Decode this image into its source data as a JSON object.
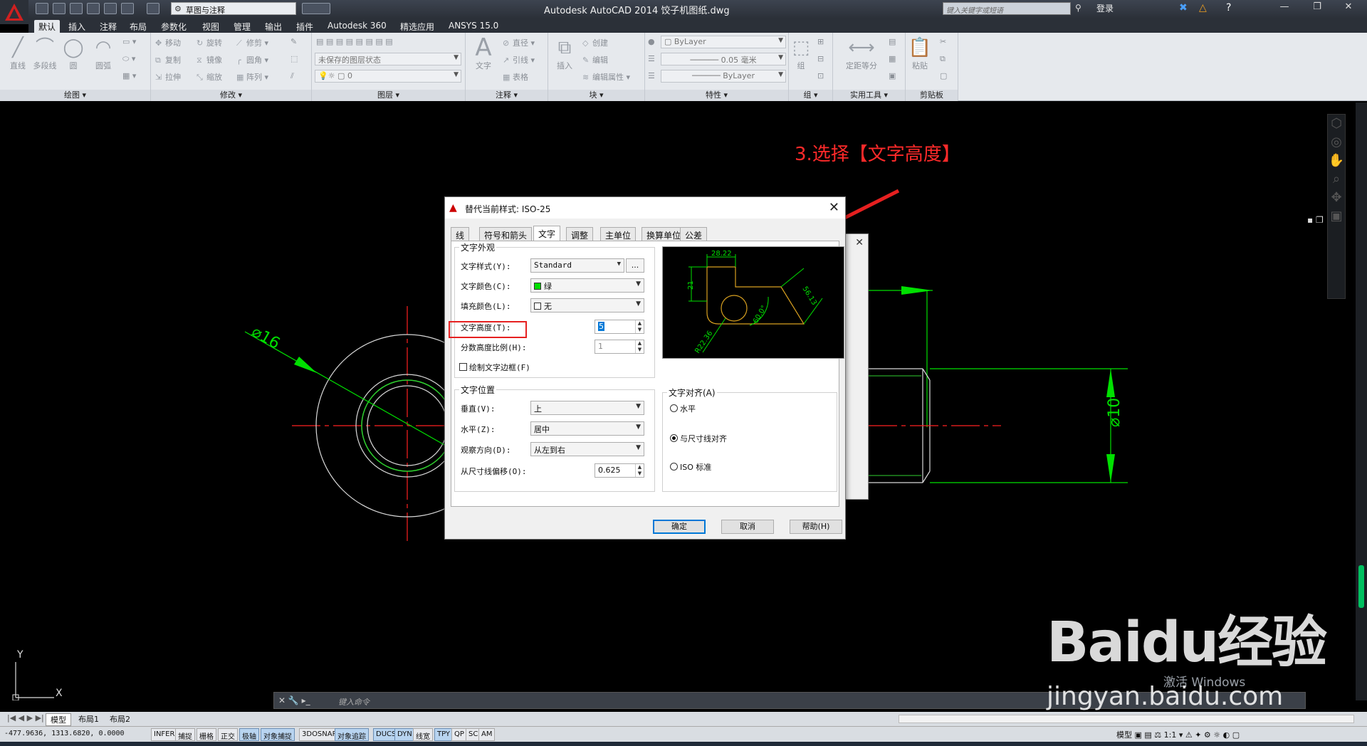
{
  "titlebar": {
    "workspace": "草图与注释",
    "title": "Autodesk AutoCAD 2014    饺子机图纸.dwg",
    "search_placeholder": "键入关键字或短语",
    "login": "登录"
  },
  "ribbon_tabs": [
    "默认",
    "插入",
    "注释",
    "布局",
    "参数化",
    "视图",
    "管理",
    "输出",
    "插件",
    "Autodesk 360",
    "精选应用",
    "ANSYS 15.0"
  ],
  "ribbon": {
    "draw": {
      "label": "绘图 ▾",
      "tools": [
        "直线",
        "多段线",
        "圆",
        "圆弧"
      ]
    },
    "modify": {
      "label": "修改 ▾",
      "tools": [
        "移动",
        "旋转",
        "修剪",
        "复制",
        "镜像",
        "圆角",
        "拉伸",
        "缩放",
        "阵列"
      ]
    },
    "layers": {
      "label": "图层 ▾",
      "state": "未保存的图层状态",
      "current": "0"
    },
    "annotation": {
      "label": "注释 ▾",
      "text": "文字",
      "tools": [
        "直径",
        "引线",
        "表格"
      ]
    },
    "block": {
      "label": "块 ▾",
      "insert": "插入",
      "tools": [
        "创建",
        "编辑",
        "编辑属性"
      ]
    },
    "properties": {
      "label": "特性 ▾",
      "color": "ByLayer",
      "lineweight": "0.05 毫米",
      "linetype": "ByLayer"
    },
    "groups": {
      "label": "组 ▾",
      "tool": "组"
    },
    "utilities": {
      "label": "实用工具 ▾",
      "tool": "定距等分"
    },
    "clipboard": {
      "label": "剪贴板",
      "tool": "粘贴"
    }
  },
  "annotation": "3.选择【文字高度】",
  "dialog": {
    "title": "替代当前样式: ISO-25",
    "tabs": [
      "线",
      "符号和箭头",
      "文字",
      "调整",
      "主单位",
      "换算单位",
      "公差"
    ],
    "active_tab": "文字",
    "appearance": {
      "legend": "文字外观",
      "style_label": "文字样式(Y):",
      "style_value": "Standard",
      "style_browse": "...",
      "color_label": "文字颜色(C):",
      "color_value": "绿",
      "fill_label": "填充颜色(L):",
      "fill_value": "无",
      "height_label": "文字高度(T):",
      "height_value": "5",
      "fraction_label": "分数高度比例(H):",
      "fraction_value": "1",
      "frame_label": "绘制文字边框(F)"
    },
    "placement": {
      "legend": "文字位置",
      "vertical_label": "垂直(V):",
      "vertical_value": "上",
      "horizontal_label": "水平(Z):",
      "horizontal_value": "居中",
      "view_label": "观察方向(D):",
      "view_value": "从左到右",
      "offset_label": "从尺寸线偏移(O):",
      "offset_value": "0.625"
    },
    "alignment": {
      "legend": "文字对齐(A)",
      "options": [
        "水平",
        "与尺寸线对齐",
        "ISO 标准"
      ],
      "selected": 1
    },
    "preview": {
      "dim_top": "28.22",
      "dim_left": "21",
      "dim_right": "56.13",
      "dim_angle": "60.0°",
      "dim_radius": "R22.36"
    },
    "buttons": {
      "ok": "确定",
      "cancel": "取消",
      "help": "帮助(H)"
    }
  },
  "drawing": {
    "dia16": "⌀16",
    "dia10": "⌀10",
    "axis_x": "X",
    "axis_y": "Y"
  },
  "cmdline": {
    "placeholder": "键入命令"
  },
  "layout_tabs": [
    "模型",
    "布局1",
    "布局2"
  ],
  "status": {
    "coords": "-477.9636, 1313.6820, 0.0000",
    "toggles": [
      "INFER",
      "捕捉",
      "栅格",
      "正交",
      "极轴",
      "对象捕捉",
      "3DOSNAP",
      "对象追踪",
      "DUCS",
      "DYN",
      "线宽",
      "TPY",
      "QP",
      "SC",
      "AM"
    ],
    "model": "模型",
    "scale": "1:1"
  },
  "watermark": {
    "logo": "Baidu经验",
    "url": "jingyan.baidu.com",
    "activate": "激活 Windows"
  },
  "colors": {
    "accent": "#00ff00",
    "annotation": "#ff2a2a",
    "crosshair": "#ff0000"
  }
}
